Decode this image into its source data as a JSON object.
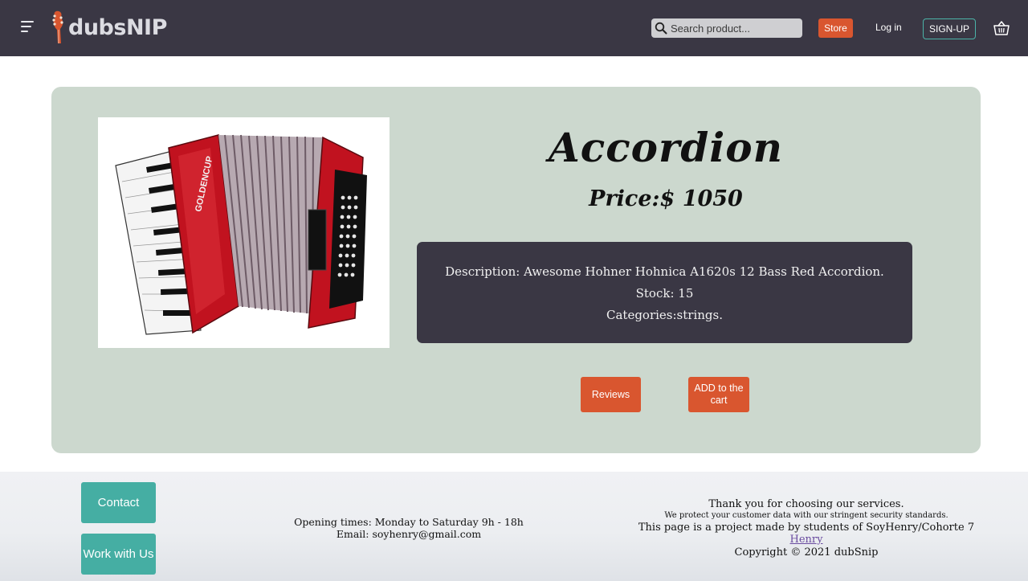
{
  "navbar": {
    "logo_text": "dubsNIP",
    "search_placeholder": "Search product...",
    "store_label": "Store",
    "login_label": "Log in",
    "signup_label": "SIGN-UP",
    "bg_color": "#3a3744",
    "accent_color": "#d9562f"
  },
  "product": {
    "name": "Accordion",
    "price": "Price:$ 1050",
    "description": "Description: Awesome Hohner Hohnica A1620s 12 Bass Red Accordion.",
    "stock": "Stock: 15",
    "categories": "Categories:strings.",
    "image_brand": "GOLDENCUP",
    "reviews_label": "Reviews",
    "add_to_cart_label": "ADD to the cart",
    "card_color": "#ccd8ce"
  },
  "footer": {
    "contact_label": "Contact",
    "work_label": "Work with Us",
    "opening_times": "Opening times: Monday to Saturday 9h - 18h",
    "email": "Email: soyhenry@gmail.com",
    "thanks": "Thank you for choosing our services.",
    "privacy": "We protect your customer data with our stringent security standards.",
    "project": "This page is a project made by students of SoyHenry/Cohorte 7",
    "henry_link": "Henry",
    "copyright": "Copyright © 2021 dubSnip",
    "button_color": "#45aea3"
  },
  "icons": {
    "menu": "hamburger-menu-icon",
    "logo": "guitar-headstock-icon",
    "search": "search-icon",
    "cart": "basket-icon"
  }
}
